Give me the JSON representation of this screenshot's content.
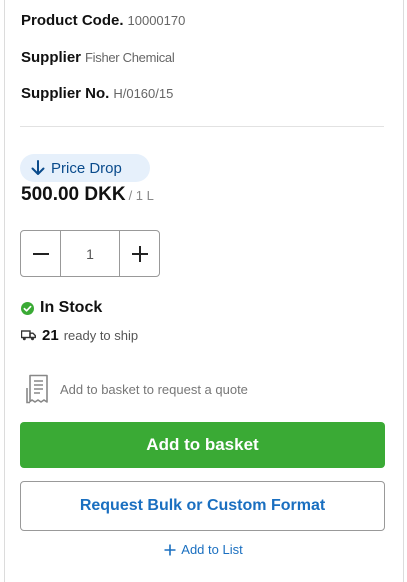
{
  "product": {
    "code_label": "Product Code.",
    "code_value": "10000170",
    "supplier_label": "Supplier",
    "supplier_value": "Fisher Chemical",
    "supplier_no_label": "Supplier No.",
    "supplier_no_value": "H/0160/15"
  },
  "pricing": {
    "badge_label": "Price Drop",
    "badge_icon": "arrow-down-icon",
    "price": "500.00 DKK",
    "unit": "/ 1 L"
  },
  "quantity": {
    "value": "1",
    "decrement_symbol": "−",
    "increment_symbol": "+"
  },
  "availability": {
    "status": "In Stock",
    "status_icon": "check-circle-icon",
    "ready_count": "21",
    "ready_text": "ready to ship",
    "ship_icon": "truck-icon"
  },
  "quote": {
    "text": "Add to basket to request a quote",
    "icon": "receipt-icon"
  },
  "actions": {
    "add_to_basket": "Add to basket",
    "request_bulk": "Request Bulk or Custom Format",
    "add_to_list": "Add to List"
  },
  "colors": {
    "primary_green": "#3aaa35",
    "link_blue": "#1a6fc0",
    "badge_bg": "#e6f0fb",
    "badge_text": "#0a4b8c",
    "stock_green": "#3aaa35"
  }
}
